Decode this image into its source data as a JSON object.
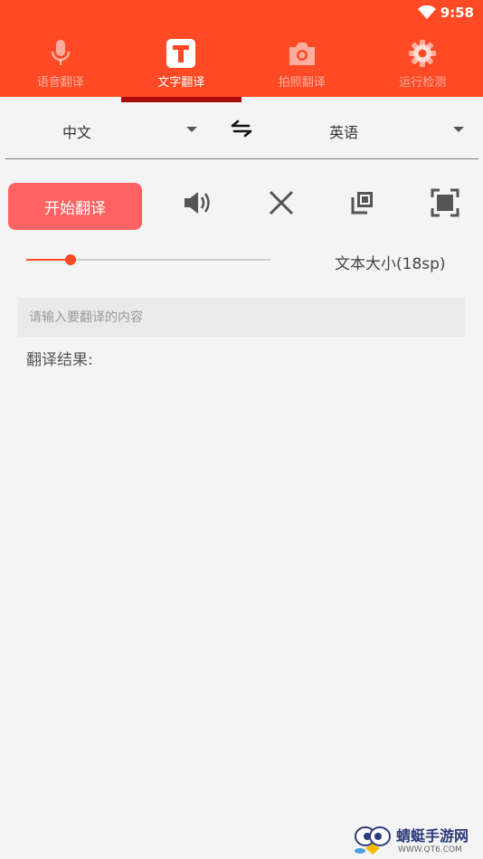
{
  "status_bar": {
    "time": "9:58",
    "wifi_icon": "wifi-icon"
  },
  "tabs": [
    {
      "label": "语音翻译",
      "icon": "microphone-icon",
      "active": false
    },
    {
      "label": "文字翻译",
      "icon": "text-t-icon",
      "active": true
    },
    {
      "label": "拍照翻译",
      "icon": "camera-icon",
      "active": false
    },
    {
      "label": "运行检测",
      "icon": "gear-icon",
      "active": false
    }
  ],
  "languages": {
    "source": "中文",
    "target": "英语",
    "swap_icon": "swap-arrows-icon"
  },
  "toolbar": {
    "start_label": "开始翻译",
    "speaker_icon": "speaker-icon",
    "clear_icon": "close-icon",
    "copy_icon": "copy-icon",
    "fullscreen_icon": "fullscreen-icon"
  },
  "text_size": {
    "label": "文本大小(18sp)",
    "value_fraction": 0.18
  },
  "input": {
    "placeholder": "请输入要翻译的内容",
    "value": ""
  },
  "result": {
    "label": "翻译结果:"
  },
  "watermark": {
    "title": "蜻蜓手游网",
    "url": "WWW.QT6.COM"
  },
  "colors": {
    "accent": "#ff4a25",
    "button": "#ff6262",
    "indicator": "#a80c0c"
  }
}
